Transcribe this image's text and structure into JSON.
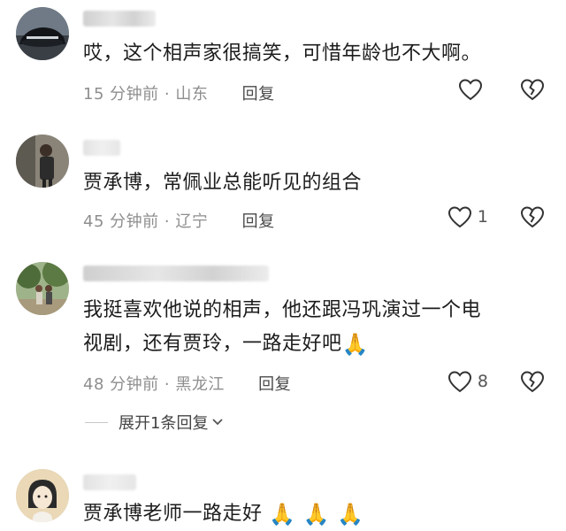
{
  "comments": [
    {
      "text": "哎，这个相声家很搞笑，可惜年龄也不大啊。",
      "time": "15 分钟前",
      "location": "山东",
      "reply_label": "回复",
      "likes": ""
    },
    {
      "text": "贾承博，常佩业总能听见的组合",
      "time": "45 分钟前",
      "location": "辽宁",
      "reply_label": "回复",
      "likes": "1"
    },
    {
      "text_line1": "我挺喜欢他说的相声，他还跟冯巩演过一个电",
      "text_line2": "视剧，还有贾玲，一路走好吧",
      "emoji": "🙏",
      "time": "48 分钟前",
      "location": "黑龙江",
      "reply_label": "回复",
      "likes": "8"
    },
    {
      "text": "贾承博老师一路走好",
      "emoji": "🙏 🙏 🙏"
    }
  ],
  "expand_replies": "展开1条回复",
  "separator": "·",
  "icons": [
    "heart-icon",
    "broken-heart-icon",
    "chevron-down-icon"
  ]
}
